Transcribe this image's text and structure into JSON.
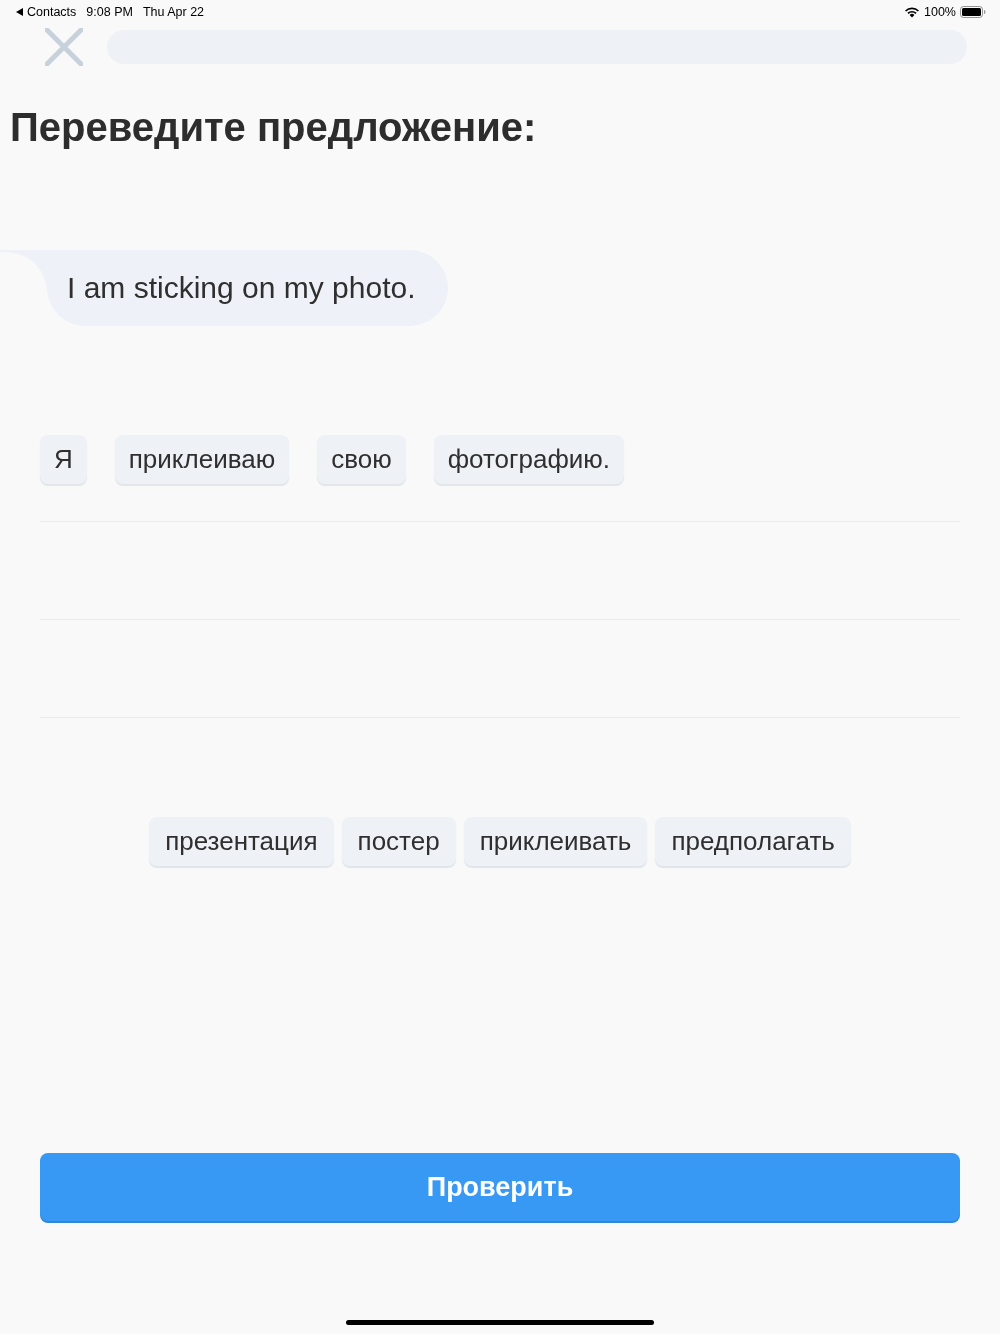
{
  "status_bar": {
    "back_label": "Contacts",
    "time": "9:08 PM",
    "date": "Thu Apr 22",
    "battery": "100%"
  },
  "progress": {
    "level": 0
  },
  "title": "Переведите предложение:",
  "prompt": {
    "text": "I am sticking on my photo."
  },
  "answer": {
    "words": [
      "Я",
      "приклеиваю",
      "свою",
      "фотографию."
    ]
  },
  "word_bank": {
    "words": [
      "презентация",
      "постер",
      "приклеивать",
      "предполагать"
    ]
  },
  "check_button": {
    "label": "Проверить"
  }
}
